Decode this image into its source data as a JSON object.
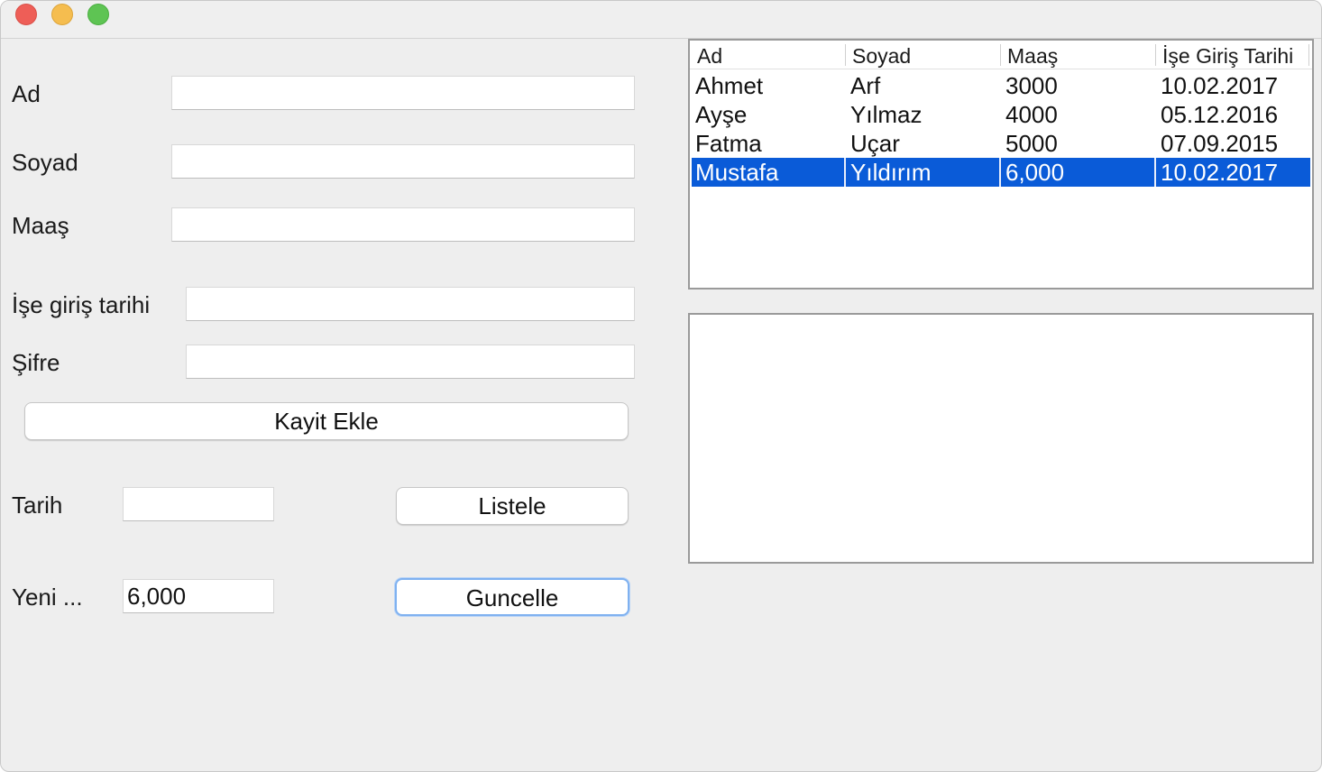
{
  "form": {
    "ad_label": "Ad",
    "ad_value": "",
    "soyad_label": "Soyad",
    "soyad_value": "",
    "maas_label": "Maaş",
    "maas_value": "",
    "ise_giris_label": "İşe giriş tarihi",
    "ise_giris_value": "",
    "sifre_label": "Şifre",
    "sifre_value": "",
    "kayit_ekle_button": "Kayit Ekle",
    "tarih_label": "Tarih",
    "tarih_value": "",
    "listele_button": "Listele",
    "yeni_label": "Yeni ...",
    "yeni_value": "6,000",
    "guncelle_button": "Guncelle"
  },
  "table": {
    "columns": [
      "Ad",
      "Soyad",
      "Maaş",
      "İşe Giriş Tarihi"
    ],
    "rows": [
      [
        "Ahmet",
        "Arf",
        "3000",
        "10.02.2017"
      ],
      [
        "Ayşe",
        "Yılmaz",
        "4000",
        "05.12.2016"
      ],
      [
        "Fatma",
        "Uçar",
        "5000",
        "07.09.2015"
      ],
      [
        "Mustafa",
        "Yıldırım",
        "6,000",
        "10.02.2017"
      ]
    ],
    "selected_row": 3
  },
  "output_area": {
    "text": ""
  },
  "colors": {
    "window_bg": "#eeeeee",
    "selection": "#0a5bd8",
    "focus_ring": "#7fb1f0",
    "close": "#ee5e57",
    "minimize": "#f5bd4f",
    "maximize": "#5ec453"
  }
}
